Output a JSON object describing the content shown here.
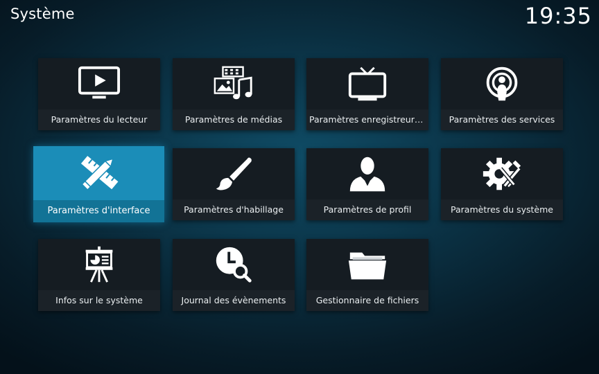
{
  "header": {
    "title": "Système",
    "clock": "19:35"
  },
  "tiles": [
    {
      "id": "player",
      "label": "Paramètres du lecteur",
      "icon": "monitor-play-icon"
    },
    {
      "id": "media",
      "label": "Paramètres de médias",
      "icon": "media-film-music-icon"
    },
    {
      "id": "pvr",
      "label": "Paramètres enregistreur /...",
      "icon": "tv-icon"
    },
    {
      "id": "services",
      "label": "Paramètres des services",
      "icon": "broadcast-user-icon"
    },
    {
      "id": "interface",
      "label": "Paramètres d'interface",
      "icon": "pencil-ruler-icon",
      "focused": true
    },
    {
      "id": "skin",
      "label": "Paramètres d'habillage",
      "icon": "paintbrush-icon"
    },
    {
      "id": "profile",
      "label": "Paramètres de profil",
      "icon": "user-profile-icon"
    },
    {
      "id": "system",
      "label": "Paramètres du système",
      "icon": "gear-tools-icon"
    },
    {
      "id": "sysinfo",
      "label": "Infos sur le système",
      "icon": "presentation-board-icon"
    },
    {
      "id": "eventlog",
      "label": "Journal des évènements",
      "icon": "clock-search-icon"
    },
    {
      "id": "filemanager",
      "label": "Gestionnaire de fichiers",
      "icon": "folder-icon"
    }
  ],
  "colors": {
    "focus": "#1b8db8",
    "tile": "#151c22"
  }
}
